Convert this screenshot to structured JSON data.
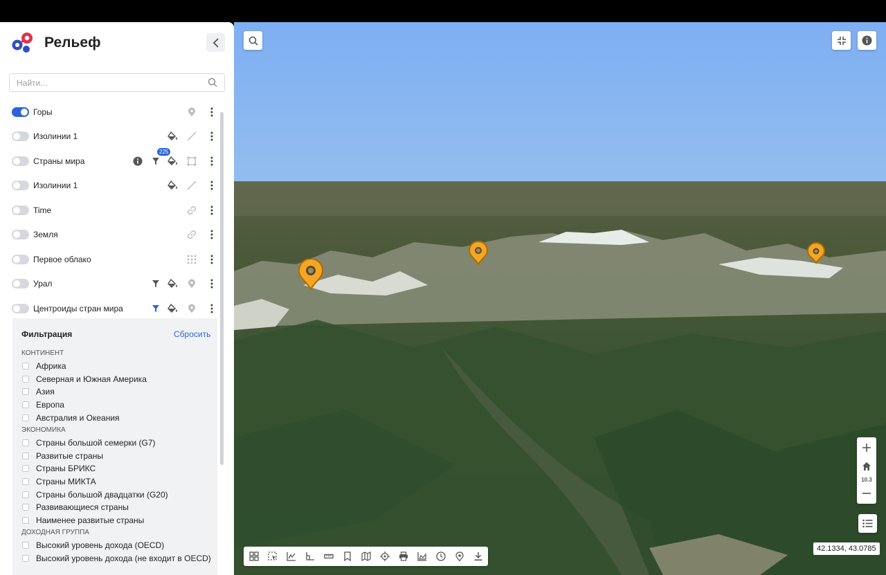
{
  "app": {
    "title": "Рельеф"
  },
  "search": {
    "placeholder": "Найти..."
  },
  "layers": [
    {
      "name": "Горы",
      "on": true
    },
    {
      "name": "Изолинии 1",
      "on": false
    },
    {
      "name": "Страны мира",
      "on": false,
      "badge": "225"
    },
    {
      "name": "Изолинии 1",
      "on": false
    },
    {
      "name": "Time",
      "on": false
    },
    {
      "name": "Земля",
      "on": false
    },
    {
      "name": "Первое облако",
      "on": false
    },
    {
      "name": "Урал",
      "on": false
    },
    {
      "name": "Центроиды стран мира",
      "on": false
    }
  ],
  "filter": {
    "title": "Фильтрация",
    "reset_label": "Сбросить",
    "groups": [
      {
        "name": "Континент",
        "options": [
          "Африка",
          "Северная и Южная Америка",
          "Азия",
          "Европа",
          "Австралия и Океания"
        ]
      },
      {
        "name": "Экономика",
        "options": [
          "Страны большой семерки (G7)",
          "Развитые страны",
          "Страны БРИКС",
          "Страны МИКТА",
          "Страны большой двадцатки (G20)",
          "Развивающиеся страны",
          "Наименее развитые страны"
        ]
      },
      {
        "name": "Доходная группа",
        "options": [
          "Высокий уровень дохода (OECD)",
          "Высокий уровень дохода (не входит в OECD)"
        ]
      }
    ]
  },
  "map": {
    "zoom_level": "10.3",
    "coordinates": "42.1334, 43.0785"
  },
  "colors": {
    "accent": "#2b64d9",
    "marker": "#f5a623"
  }
}
